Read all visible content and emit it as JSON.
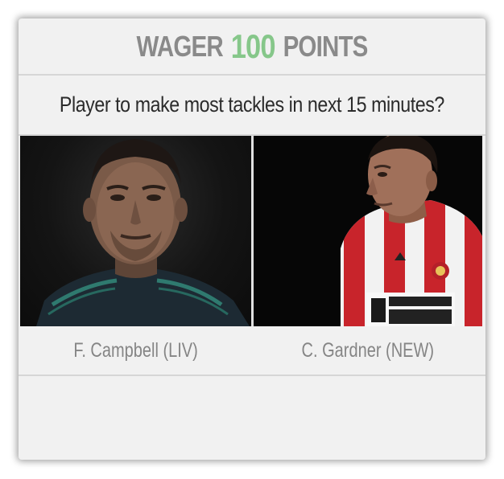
{
  "header": {
    "prefix": "WAGER",
    "amount": "100",
    "suffix": "POINTS"
  },
  "question": "Player to make most tackles in next 15 minutes?",
  "options": [
    {
      "name": "F. Campbell (LIV)",
      "photo_icon": "player-photo-dark-shirt"
    },
    {
      "name": "C. Gardner (NEW)",
      "photo_icon": "player-photo-striped-shirt"
    }
  ],
  "colors": {
    "amount_accent": "#86c78a",
    "label_gray": "#8a8a8a",
    "card_background": "#f1f1f1"
  }
}
